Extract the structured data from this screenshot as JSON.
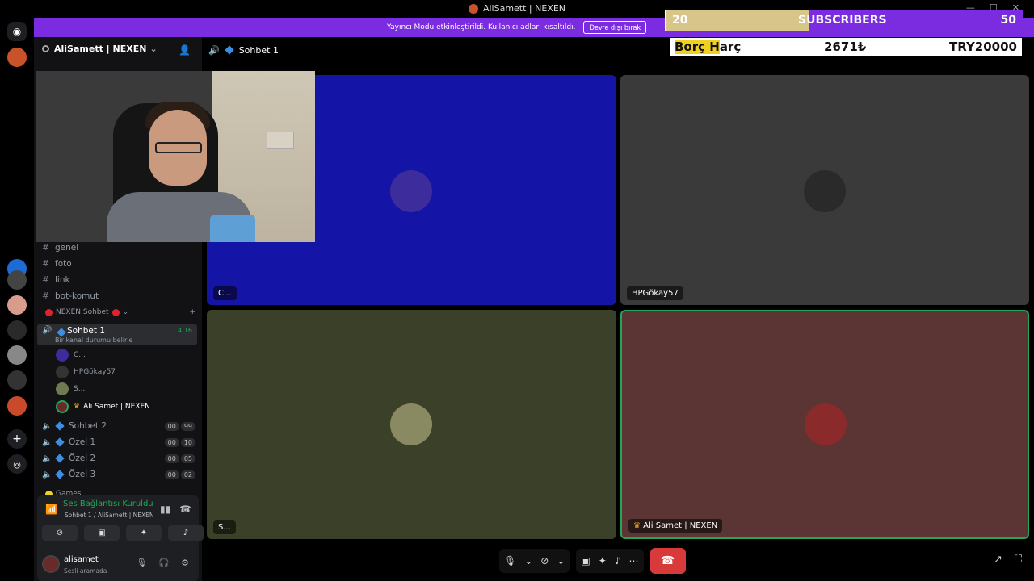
{
  "window": {
    "title": "AliSamett | NEXEN"
  },
  "banner": {
    "message": "Yayıncı Modu etkinleştirildi. Kullanıcı adları kısaltıldı.",
    "disable_button": "Devre dışı bırak"
  },
  "server": {
    "name": "AliSamett | NEXEN"
  },
  "channels": [
    {
      "name": "genel"
    },
    {
      "name": "foto"
    },
    {
      "name": "link"
    },
    {
      "name": "bot-komut"
    }
  ],
  "category": {
    "name": "NEXEN Sohbet"
  },
  "active_channel": {
    "name": "Sohbet 1",
    "status": "Bir kanal durumu belirle",
    "time": "4:16"
  },
  "members": [
    {
      "name": "C..."
    },
    {
      "name": "HPGökay57"
    },
    {
      "name": "S..."
    },
    {
      "name": "Ali Samet | NEXEN"
    }
  ],
  "voice_channels": [
    {
      "name": "Sohbet 2",
      "c1": "00",
      "c2": "99"
    },
    {
      "name": "Özel 1",
      "c1": "00",
      "c2": "10"
    },
    {
      "name": "Özel 2",
      "c1": "00",
      "c2": "05"
    },
    {
      "name": "Özel 3",
      "c1": "00",
      "c2": "02"
    }
  ],
  "next_category": {
    "name": "Games"
  },
  "voice_panel": {
    "status": "Ses Bağlantısı Kuruldu",
    "sub": "Sohbet 1 / AliSamett | NEXEN"
  },
  "user": {
    "name": "alisamet",
    "status": "Sesli aramada"
  },
  "main_header": {
    "channel": "Sohbet 1"
  },
  "overlay": {
    "sub_left": "20",
    "sub_label": "SUBSCRIBERS",
    "sub_right": "50",
    "debt_title_a": "Borç ",
    "debt_title_b": "H",
    "debt_title_c": "arç",
    "debt_value": "2671₺",
    "debt_goal": "TRY20000"
  },
  "tiles": [
    {
      "label": "C...",
      "color": "#1414a6"
    },
    {
      "label": "HPGökay57",
      "color": "#3a3a3a"
    },
    {
      "label": "S...",
      "color": "#3b4128"
    },
    {
      "label": "Ali Samet | NEXEN",
      "color": "#5a3533"
    }
  ],
  "colors": {
    "accent": "#7b2be0",
    "speaking": "#23a55a",
    "hangup": "#d83a3a"
  }
}
